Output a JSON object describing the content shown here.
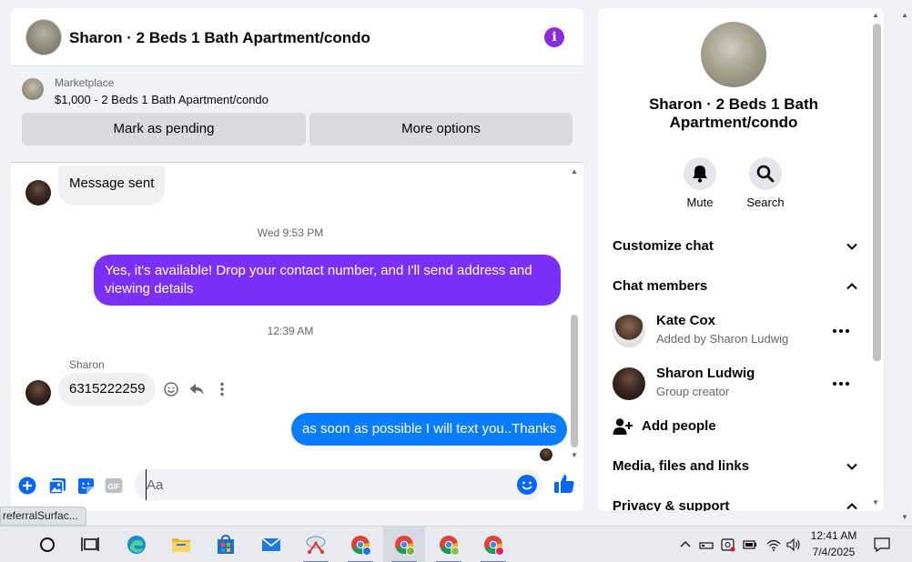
{
  "chat": {
    "title": "Sharon · 2 Beds 1 Bath Apartment/condo",
    "marketplace_label": "Marketplace",
    "listing": "$1,000 - 2 Beds 1 Bath Apartment/condo",
    "mark_pending": "Mark as pending",
    "more_options": "More options",
    "messages": {
      "sent_status": "Message sent",
      "ts1": "Wed 9:53 PM",
      "out1": "Yes, it's available! Drop your contact number, and I'll send address and viewing details",
      "ts2": "12:39 AM",
      "sender": "Sharon",
      "in_phone": "6315222259",
      "out2": "as soon as possible I will text you..Thanks"
    },
    "composer_placeholder": "Aa",
    "gif_label": "GIF"
  },
  "info": {
    "name": "Sharon · 2 Beds 1 Bath Apartment/condo",
    "mute": "Mute",
    "search": "Search",
    "customize": "Customize chat",
    "members_heading": "Chat members",
    "members": [
      {
        "name": "Kate Cox",
        "sub": "Added by Sharon Ludwig"
      },
      {
        "name": "Sharon Ludwig",
        "sub": "Group creator"
      }
    ],
    "add_people": "Add people",
    "media": "Media, files and links",
    "privacy": "Privacy & support"
  },
  "status_tip": "referralSurfac...",
  "taskbar": {
    "time": "12:41 AM",
    "date": "7/4/2025"
  },
  "colors": {
    "messenger_purple": "#7b2ff7",
    "messenger_blue": "#0a7cff",
    "accent_blue": "#0866ff"
  }
}
